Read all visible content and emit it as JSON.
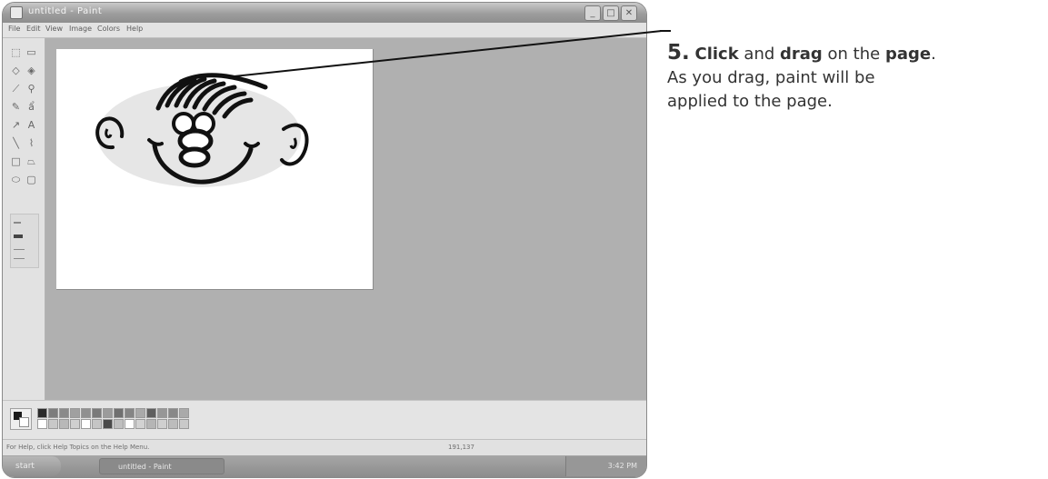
{
  "window": {
    "title": "untitled - Paint",
    "buttons": [
      "_",
      "□",
      "✕"
    ]
  },
  "menu": [
    "File",
    "Edit",
    "View",
    "Image",
    "Colors",
    "Help"
  ],
  "tools": [
    "free-select-icon",
    "select-icon",
    "eraser-icon",
    "fill-icon",
    "pick-color-icon",
    "magnifier-icon",
    "pencil-icon",
    "brush-icon",
    "airbrush-icon",
    "text-icon",
    "line-icon",
    "curve-icon",
    "rectangle-icon",
    "polygon-icon",
    "ellipse-icon",
    "rounded-rectangle-icon"
  ],
  "palette": {
    "top_row": [
      "#2b2b2b",
      "#7d7d7d",
      "#8a8a8a",
      "#a0a0a0",
      "#909090",
      "#7a7a7a",
      "#9b9b9b",
      "#6f6f6f",
      "#858585",
      "#a9a9a9",
      "#5f5f5f",
      "#979797",
      "#888888",
      "#aaaaaa"
    ],
    "bottom_row": [
      "#ffffff",
      "#c8c8c8",
      "#b8b8b8",
      "#d0d0d0",
      "#ffffff",
      "#c5c5c5",
      "#4a4a4a",
      "#bfbfbf",
      "#ffffff",
      "#d2d2d2",
      "#b5b5b5",
      "#cfcfcf",
      "#bcbcbc",
      "#c9c9c9"
    ]
  },
  "status": {
    "help_text": "For Help, click Help Topics on the Help Menu.",
    "coordinates": "191,137"
  },
  "taskbar": {
    "start_label": "start",
    "task_label": "untitled - Paint",
    "time": "3:42 PM"
  },
  "instruction": {
    "step_number": "5.",
    "word_click": "Click",
    "text_and": " and ",
    "word_drag": "drag",
    "text_on_the": " on the ",
    "word_page": "page",
    "text_period": ".",
    "body": "As you drag, paint will be applied to the page."
  },
  "colors": {
    "workspace": "#b0b0b0",
    "canvas": "#ffffff",
    "ink": "#111111",
    "face_fill": "#e6e6e6"
  }
}
